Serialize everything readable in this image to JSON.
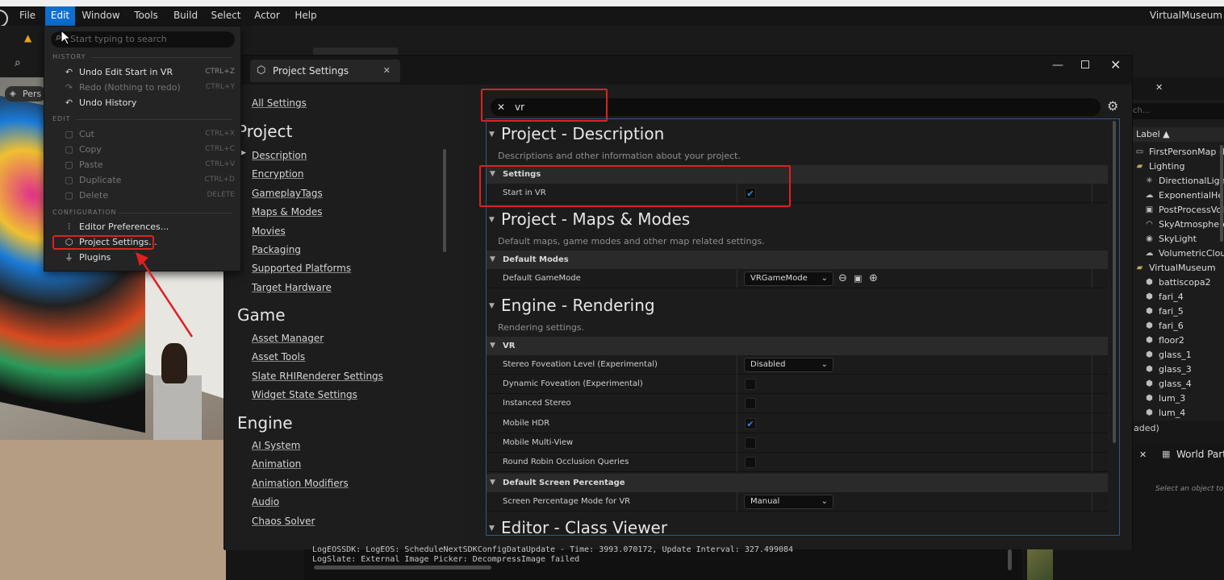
{
  "menubar": {
    "items": [
      "File",
      "Edit",
      "Window",
      "Tools",
      "Build",
      "Select",
      "Actor",
      "Help"
    ],
    "active": "Edit",
    "window_title": "VirtualMuseum"
  },
  "viewport": {
    "perspective_label": "Pers"
  },
  "edit_menu": {
    "search_placeholder": "Start typing to search",
    "sections": [
      {
        "header": "HISTORY",
        "items": [
          {
            "label": "Undo Edit Start in VR",
            "shortcut": "CTRL+Z",
            "enabled": true,
            "icon": "undo-icon"
          },
          {
            "label": "Redo (Nothing to redo)",
            "shortcut": "CTRL+Y",
            "enabled": false,
            "icon": "redo-icon"
          },
          {
            "label": "Undo History",
            "shortcut": "",
            "enabled": true,
            "icon": "history-icon"
          }
        ]
      },
      {
        "header": "EDIT",
        "items": [
          {
            "label": "Cut",
            "shortcut": "CTRL+X",
            "enabled": false,
            "icon": "cut-icon"
          },
          {
            "label": "Copy",
            "shortcut": "CTRL+C",
            "enabled": false,
            "icon": "copy-icon"
          },
          {
            "label": "Paste",
            "shortcut": "CTRL+V",
            "enabled": false,
            "icon": "paste-icon"
          },
          {
            "label": "Duplicate",
            "shortcut": "CTRL+D",
            "enabled": false,
            "icon": "duplicate-icon"
          },
          {
            "label": "Delete",
            "shortcut": "DELETE",
            "enabled": false,
            "icon": "delete-icon"
          }
        ]
      },
      {
        "header": "CONFIGURATION",
        "items": [
          {
            "label": "Editor Preferences...",
            "shortcut": "",
            "enabled": true,
            "icon": "sliders-icon"
          },
          {
            "label": "Project Settings...",
            "shortcut": "",
            "enabled": true,
            "icon": "project-settings-icon"
          },
          {
            "label": "Plugins",
            "shortcut": "",
            "enabled": true,
            "icon": "plugin-icon"
          }
        ]
      }
    ]
  },
  "project_settings": {
    "tab_title": "Project Settings",
    "all_settings": "All Settings",
    "nav": [
      {
        "heading": "Project",
        "links": [
          "Description",
          "Encryption",
          "GameplayTags",
          "Maps & Modes",
          "Movies",
          "Packaging",
          "Supported Platforms",
          "Target Hardware"
        ]
      },
      {
        "heading": "Game",
        "links": [
          "Asset Manager",
          "Asset Tools",
          "Slate RHIRenderer Settings",
          "Widget State Settings"
        ]
      },
      {
        "heading": "Engine",
        "links": [
          "AI System",
          "Animation",
          "Animation Modifiers",
          "Audio",
          "Chaos Solver"
        ]
      }
    ],
    "search_value": "vr",
    "categories": [
      {
        "title": "Project - Description",
        "desc": "Descriptions and other information about your project.",
        "groups": [
          {
            "name": "Settings",
            "props": [
              {
                "name": "Start in VR",
                "type": "checkbox",
                "checked": true
              }
            ]
          }
        ]
      },
      {
        "title": "Project - Maps & Modes",
        "desc": "Default maps, game modes and other map related settings.",
        "groups": [
          {
            "name": "Default Modes",
            "props": [
              {
                "name": "Default GameMode",
                "type": "dropdown",
                "value": "VRGameMode"
              }
            ]
          }
        ]
      },
      {
        "title": "Engine - Rendering",
        "desc": "Rendering settings.",
        "groups": [
          {
            "name": "VR",
            "props": [
              {
                "name": "Stereo Foveation Level (Experimental)",
                "type": "dropdown",
                "value": "Disabled"
              },
              {
                "name": "Dynamic Foveation (Experimental)",
                "type": "checkbox",
                "checked": false
              },
              {
                "name": "Instanced Stereo",
                "type": "checkbox",
                "checked": false
              },
              {
                "name": "Mobile HDR",
                "type": "checkbox",
                "checked": true
              },
              {
                "name": "Mobile Multi-View",
                "type": "checkbox",
                "checked": false
              },
              {
                "name": "Round Robin Occlusion Queries",
                "type": "checkbox",
                "checked": false
              }
            ]
          },
          {
            "name": "Default Screen Percentage",
            "props": [
              {
                "name": "Screen Percentage Mode for VR",
                "type": "dropdown",
                "value": "Manual"
              }
            ]
          }
        ]
      },
      {
        "title": "Editor - Class Viewer",
        "desc": "",
        "groups": []
      }
    ]
  },
  "outliner": {
    "search_placeholder": "ch...",
    "column_label": "Label ▲",
    "items": [
      {
        "label": "FirstPersonMap (Ed",
        "icon": "map-icon",
        "indent": 0
      },
      {
        "label": "Lighting",
        "icon": "folder-icon",
        "indent": 0
      },
      {
        "label": "DirectionalLight",
        "icon": "sun-icon",
        "indent": 1
      },
      {
        "label": "ExponentialHeig",
        "icon": "fog-icon",
        "indent": 1
      },
      {
        "label": "PostProcessVol",
        "icon": "postprocess-icon",
        "indent": 1
      },
      {
        "label": "SkyAtmosphere",
        "icon": "sky-icon",
        "indent": 1
      },
      {
        "label": "SkyLight",
        "icon": "skylight-icon",
        "indent": 1
      },
      {
        "label": "VolumetricCloud",
        "icon": "cloud-icon",
        "indent": 1
      },
      {
        "label": "VirtualMuseum",
        "icon": "folder-icon",
        "indent": 0
      },
      {
        "label": "battiscopa2",
        "icon": "mesh-icon",
        "indent": 1
      },
      {
        "label": "fari_4",
        "icon": "mesh-icon",
        "indent": 1
      },
      {
        "label": "fari_5",
        "icon": "mesh-icon",
        "indent": 1
      },
      {
        "label": "fari_6",
        "icon": "mesh-icon",
        "indent": 1
      },
      {
        "label": "floor2",
        "icon": "mesh-icon",
        "indent": 1
      },
      {
        "label": "glass_1",
        "icon": "mesh-icon",
        "indent": 1
      },
      {
        "label": "glass_3",
        "icon": "mesh-icon",
        "indent": 1
      },
      {
        "label": "glass_4",
        "icon": "mesh-icon",
        "indent": 1
      },
      {
        "label": "lum_3",
        "icon": "mesh-icon",
        "indent": 1
      },
      {
        "label": "lum_4",
        "icon": "mesh-icon",
        "indent": 1
      }
    ],
    "footer": "aded)"
  },
  "world_partition": {
    "tab": "World Parti",
    "hint": "Select an object to"
  },
  "log": {
    "lines": [
      "LogEOSSDK: LogEOS: ScheduleNextSDKConfigDataUpdate - Time: 3993.070172, Update Interval: 327.499084",
      "LogSlate: External Image Picker: DecompressImage failed"
    ]
  }
}
